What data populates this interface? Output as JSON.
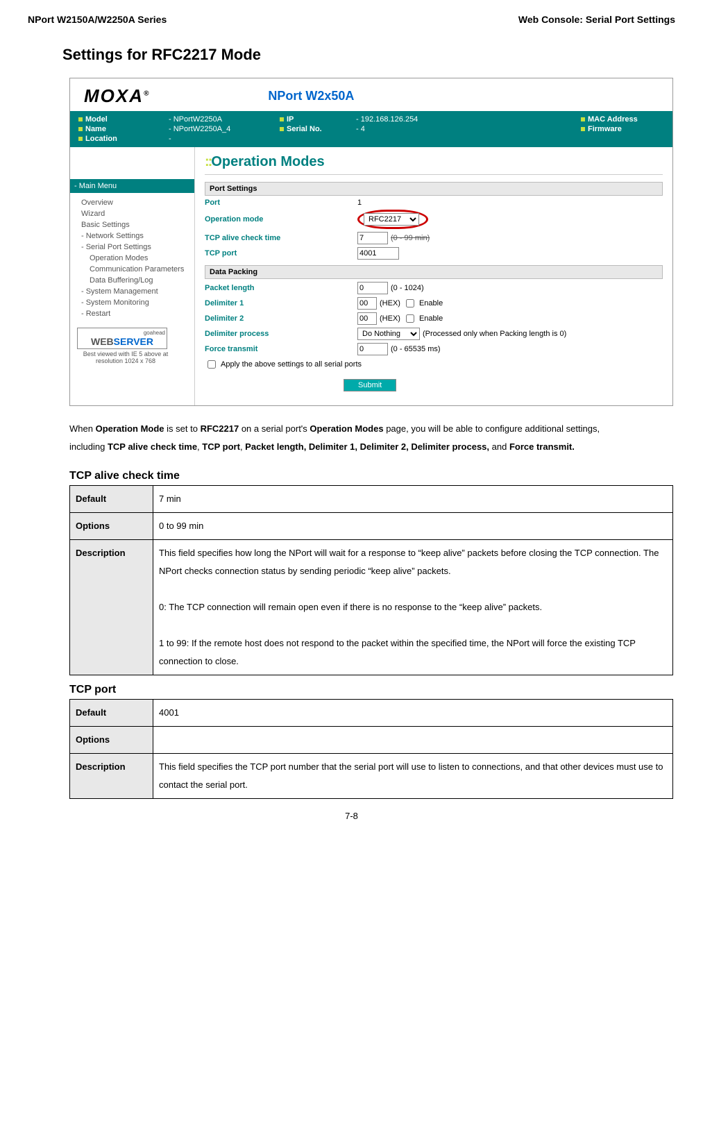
{
  "header": {
    "left": "NPort W2150A/W2250A Series",
    "right": "Web Console: Serial Port Settings"
  },
  "section_title": "Settings for RFC2217 Mode",
  "screenshot": {
    "logo_text": "MOXA",
    "device_title": "NPort W2x50A",
    "infobar": {
      "model_label": "Model",
      "model_value": "- NPortW2250A",
      "name_label": "Name",
      "name_value": "- NPortW2250A_4",
      "location_label": "Location",
      "location_value": "-",
      "ip_label": "IP",
      "ip_value": "- 192.168.126.254",
      "serial_label": "Serial No.",
      "serial_value": "- 4",
      "mac_label": "MAC Address",
      "fw_label": "Firmware"
    },
    "side": {
      "main_menu": "- Main Menu",
      "items": [
        "Overview",
        "Wizard",
        "Basic Settings",
        "- Network Settings",
        "- Serial Port Settings"
      ],
      "sub_items": [
        "Operation Modes",
        "Communication Parameters",
        "Data Buffering/Log"
      ],
      "tail_items": [
        "- System Management",
        "- System Monitoring",
        "- Restart"
      ],
      "ws_top": "goahead",
      "ws_web": "WEB",
      "ws_srv": "SERVER",
      "ws_note": "Best viewed with IE 5 above at resolution 1024 x 768"
    },
    "main": {
      "title": "Operation Modes",
      "port_settings_header": "Port Settings",
      "port_label": "Port",
      "port_value": "1",
      "opmode_label": "Operation mode",
      "opmode_value": "RFC2217",
      "tcp_alive_label": "TCP alive check time",
      "tcp_alive_value": "7",
      "tcp_alive_hint": "(0 - 99 min)",
      "tcp_port_label": "TCP port",
      "tcp_port_value": "4001",
      "data_packing_header": "Data Packing",
      "packet_len_label": "Packet length",
      "packet_len_value": "0",
      "packet_len_hint": "(0 - 1024)",
      "delim1_label": "Delimiter 1",
      "delim1_value": "00",
      "delim1_enable_label": "Enable",
      "delim2_label": "Delimiter 2",
      "delim2_value": "00",
      "delim2_enable_label": "Enable",
      "delim_proc_label": "Delimiter process",
      "delim_proc_value": "Do Nothing",
      "delim_proc_hint": "(Processed only when Packing length is 0)",
      "force_label": "Force transmit",
      "force_value": "0",
      "force_hint": "(0 - 65535 ms)",
      "hex_label": "(HEX)",
      "apply_all_label": "Apply the above settings to all serial ports",
      "submit_label": "Submit"
    }
  },
  "paragraph": {
    "p1_a": "When ",
    "p1_b": "Operation Mode",
    "p1_c": " is set to ",
    "p1_d": "RFC2217",
    "p1_e": " on a serial port's ",
    "p1_f": "Operation Modes",
    "p1_g": " page, you will be able to configure additional settings, including ",
    "p1_h": "TCP alive check time",
    "p1_i": ", ",
    "p1_j": "TCP port",
    "p1_k": ", ",
    "p1_l": "Packet length, Delimiter 1, Delimiter 2, Delimiter process,",
    "p1_m": " and ",
    "p1_n": "Force transmit."
  },
  "tcp_alive": {
    "heading": "TCP alive check time",
    "default_label": "Default",
    "default_value": "7 min",
    "options_label": "Options",
    "options_value": "0 to 99 min",
    "desc_label": "Description",
    "desc_p1": "This field specifies how long the NPort will wait for a response to “keep alive” packets before closing the TCP connection. The NPort checks connection status by sending periodic “keep alive” packets.",
    "desc_p2": "0: The TCP connection will remain open even if there is no response to the “keep alive” packets.",
    "desc_p3": "1 to 99: If the remote host does not respond to the packet within the specified time, the NPort will force the existing TCP connection to close."
  },
  "tcp_port": {
    "heading": "TCP port",
    "default_label": "Default",
    "default_value": "4001",
    "options_label": "Options",
    "options_value": "",
    "desc_label": "Description",
    "desc_value": "This field specifies the TCP port number that the serial port will use to listen to connections, and that other devices must use to contact the serial port."
  },
  "page_number": "7-8"
}
